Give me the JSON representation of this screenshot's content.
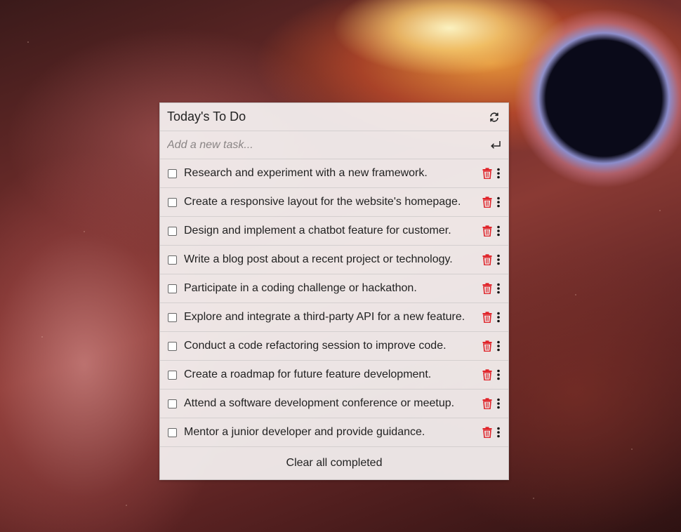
{
  "app": {
    "title": "Today's To Do",
    "refresh_icon": "refresh-icon"
  },
  "new_task": {
    "placeholder": "Add a new task...",
    "value": "",
    "submit_icon": "enter-icon"
  },
  "tasks": [
    {
      "text": "Research and experiment with a new framework.",
      "completed": false
    },
    {
      "text": "Create a responsive layout for the website's homepage.",
      "completed": false
    },
    {
      "text": "Design and implement a chatbot feature for customer.",
      "completed": false
    },
    {
      "text": "Write a blog post about a recent project or technology.",
      "completed": false
    },
    {
      "text": "Participate in a coding challenge or hackathon.",
      "completed": false
    },
    {
      "text": "Explore and integrate a third-party API for a new feature.",
      "completed": false
    },
    {
      "text": "Conduct a code refactoring session to improve code.",
      "completed": false
    },
    {
      "text": "Create a roadmap for future feature development.",
      "completed": false
    },
    {
      "text": "Attend a software development conference or meetup.",
      "completed": false
    },
    {
      "text": "Mentor a junior developer and provide guidance.",
      "completed": false
    }
  ],
  "task_icons": {
    "delete": "trash-icon",
    "more": "more-vertical-icon"
  },
  "footer": {
    "clear_label": "Clear all completed"
  },
  "colors": {
    "delete_icon": "#e0242a",
    "panel_bg": "#f5f2f2",
    "text": "#222222"
  }
}
